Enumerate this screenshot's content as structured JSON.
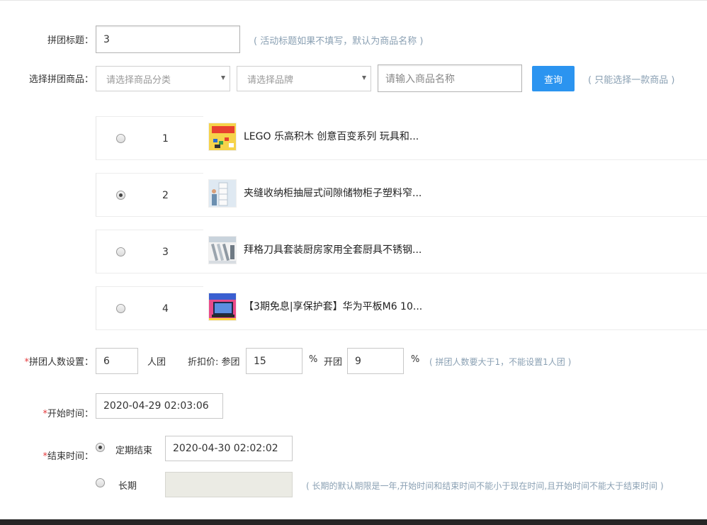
{
  "title_field": {
    "label": "拼团标题：",
    "value": "3",
    "hint": "( 活动标题如果不填写，默认为商品名称 )"
  },
  "product_select": {
    "label": "选择拼团商品：",
    "category_placeholder": "请选择商品分类",
    "brand_placeholder": "请选择品牌",
    "name_placeholder": "请输入商品名称",
    "search_button": "查询",
    "hint": "( 只能选择一款商品 )"
  },
  "products": [
    {
      "index": "1",
      "name": "LEGO 乐高积木 创意百变系列 玩具和...",
      "selected": false,
      "thumb_icon": "lego-box-thumbnail"
    },
    {
      "index": "2",
      "name": "夹缝收纳柜抽屉式间隙储物柜子塑料窄...",
      "selected": true,
      "thumb_icon": "storage-cabinet-thumbnail"
    },
    {
      "index": "3",
      "name": "拜格刀具套装厨房家用全套厨具不锈钢...",
      "selected": false,
      "thumb_icon": "knife-set-thumbnail"
    },
    {
      "index": "4",
      "name": "【3期免息|享保护套】华为平板M6 10...",
      "selected": false,
      "thumb_icon": "tablet-thumbnail"
    }
  ],
  "group_settings": {
    "required_mark": "*",
    "label": "拼团人数设置：",
    "people_value": "6",
    "people_unit": "人团",
    "discount_label": "折扣价: 参团",
    "join_value": "15",
    "percent1": "%",
    "open_label": "开团",
    "open_value": "9",
    "percent2": "%",
    "hint": "( 拼团人数要大于1，不能设置1人团 )"
  },
  "start_time": {
    "required_mark": "*",
    "label": "开始时间：",
    "value": "2020-04-29 02:03:06"
  },
  "end_time": {
    "required_mark": "*",
    "label": "结束时间：",
    "option_fixed": "定期结束",
    "fixed_value": "2020-04-30 02:02:02",
    "option_long": "长期",
    "long_value": "",
    "fixed_selected": true,
    "hint": "( 长期的默认期限是一年,开始时间和结束时间不能小于现在时间,且开始时间不能大于结束时间 )"
  },
  "colors": {
    "accent": "#2b94f0",
    "required": "#e4393c",
    "hint": "#8aa0b3"
  }
}
